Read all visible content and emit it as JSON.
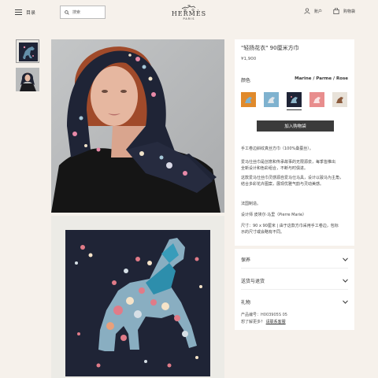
{
  "header": {
    "menu_label": "目录",
    "search_placeholder": "搜索",
    "logo_brand": "HERMÈS",
    "logo_city": "PARIS",
    "account_label": "账户",
    "cart_label": "购物袋"
  },
  "product": {
    "title": "\"轻扬花衣\" 90厘米方巾",
    "price": "¥1,900",
    "color_label": "颜色",
    "color_value": "Marine / Parme / Rose",
    "swatches": [
      {
        "name": "orange",
        "bg": "#e08a2c"
      },
      {
        "name": "blue",
        "bg": "#7fb2cf"
      },
      {
        "name": "navy",
        "bg": "#1f2436"
      },
      {
        "name": "pink",
        "bg": "#e88d8d"
      },
      {
        "name": "beige",
        "bg": "#e8e2d9"
      }
    ],
    "add_to_cart": "加入购物袋",
    "description": {
      "line1": "手工卷边斜纹真丝方巾（100%桑蚕丝）。",
      "para2_l1": "爱马仕丝巾是创意和传承故事的无限源泉，每季皆推出",
      "para2_l2": "全新设计和色彩组合，不断与时俱进。",
      "para3_l1": "这款爱马仕丝巾灵感源自爱马仕马具，设计以骏马为主角，",
      "para3_l2": "结合多彩花卉图案，展现优雅气韵与灵动美感。",
      "para4": "法国制造。",
      "para5": "设计师 皮埃尔·马里（Pierre Marie）",
      "size_l1": "尺寸：90 x 90厘米 | 由于这款方巾采用手工卷边，包标",
      "size_l2": "示的尺寸或会略有不同。"
    }
  },
  "accordion": {
    "care": "保养",
    "shipping": "送货与退货",
    "gift": "礼物",
    "product_code": "产品编号：H003905S 05",
    "more_q": "想了解更多？",
    "contact_link": "请联系客服"
  },
  "colors": {
    "page_bg": "#f6f1eb",
    "button_bg": "#3b3b3b",
    "scarf_navy": "#1f2436"
  }
}
